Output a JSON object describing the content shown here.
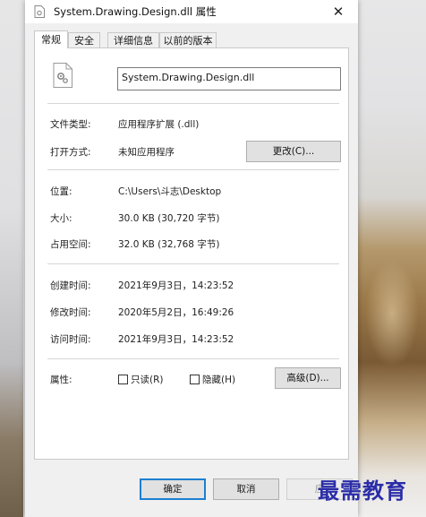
{
  "window": {
    "title": "System.Drawing.Design.dll 属性",
    "close_glyph": "✕"
  },
  "tabs": [
    {
      "label": "常规",
      "active": true
    },
    {
      "label": "安全",
      "active": false
    },
    {
      "label": "详细信息",
      "active": false
    },
    {
      "label": "以前的版本",
      "active": false
    }
  ],
  "general": {
    "file_name": "System.Drawing.Design.dll",
    "file_type_label": "文件类型:",
    "file_type_value": "应用程序扩展 (.dll)",
    "opens_with_label": "打开方式:",
    "opens_with_value": "未知应用程序",
    "change_button": "更改(C)...",
    "location_label": "位置:",
    "location_value": "C:\\Users\\斗志\\Desktop",
    "size_label": "大小:",
    "size_value": "30.0 KB (30,720 字节)",
    "size_on_disk_label": "占用空间:",
    "size_on_disk_value": "32.0 KB (32,768 字节)",
    "created_label": "创建时间:",
    "created_value": "2021年9月3日，14:23:52",
    "modified_label": "修改时间:",
    "modified_value": "2020年5月2日，16:49:26",
    "accessed_label": "访问时间:",
    "accessed_value": "2021年9月3日，14:23:52",
    "attributes_label": "属性:",
    "readonly_label": "只读(R)",
    "readonly_checked": false,
    "hidden_label": "隐藏(H)",
    "hidden_checked": false,
    "advanced_button": "高级(D)..."
  },
  "footer": {
    "ok": "确定",
    "cancel": "取消",
    "apply": "应"
  },
  "watermark": "最需教育",
  "colors": {
    "default_button_border": "#1b7fd1",
    "watermark": "#2a2da8"
  }
}
